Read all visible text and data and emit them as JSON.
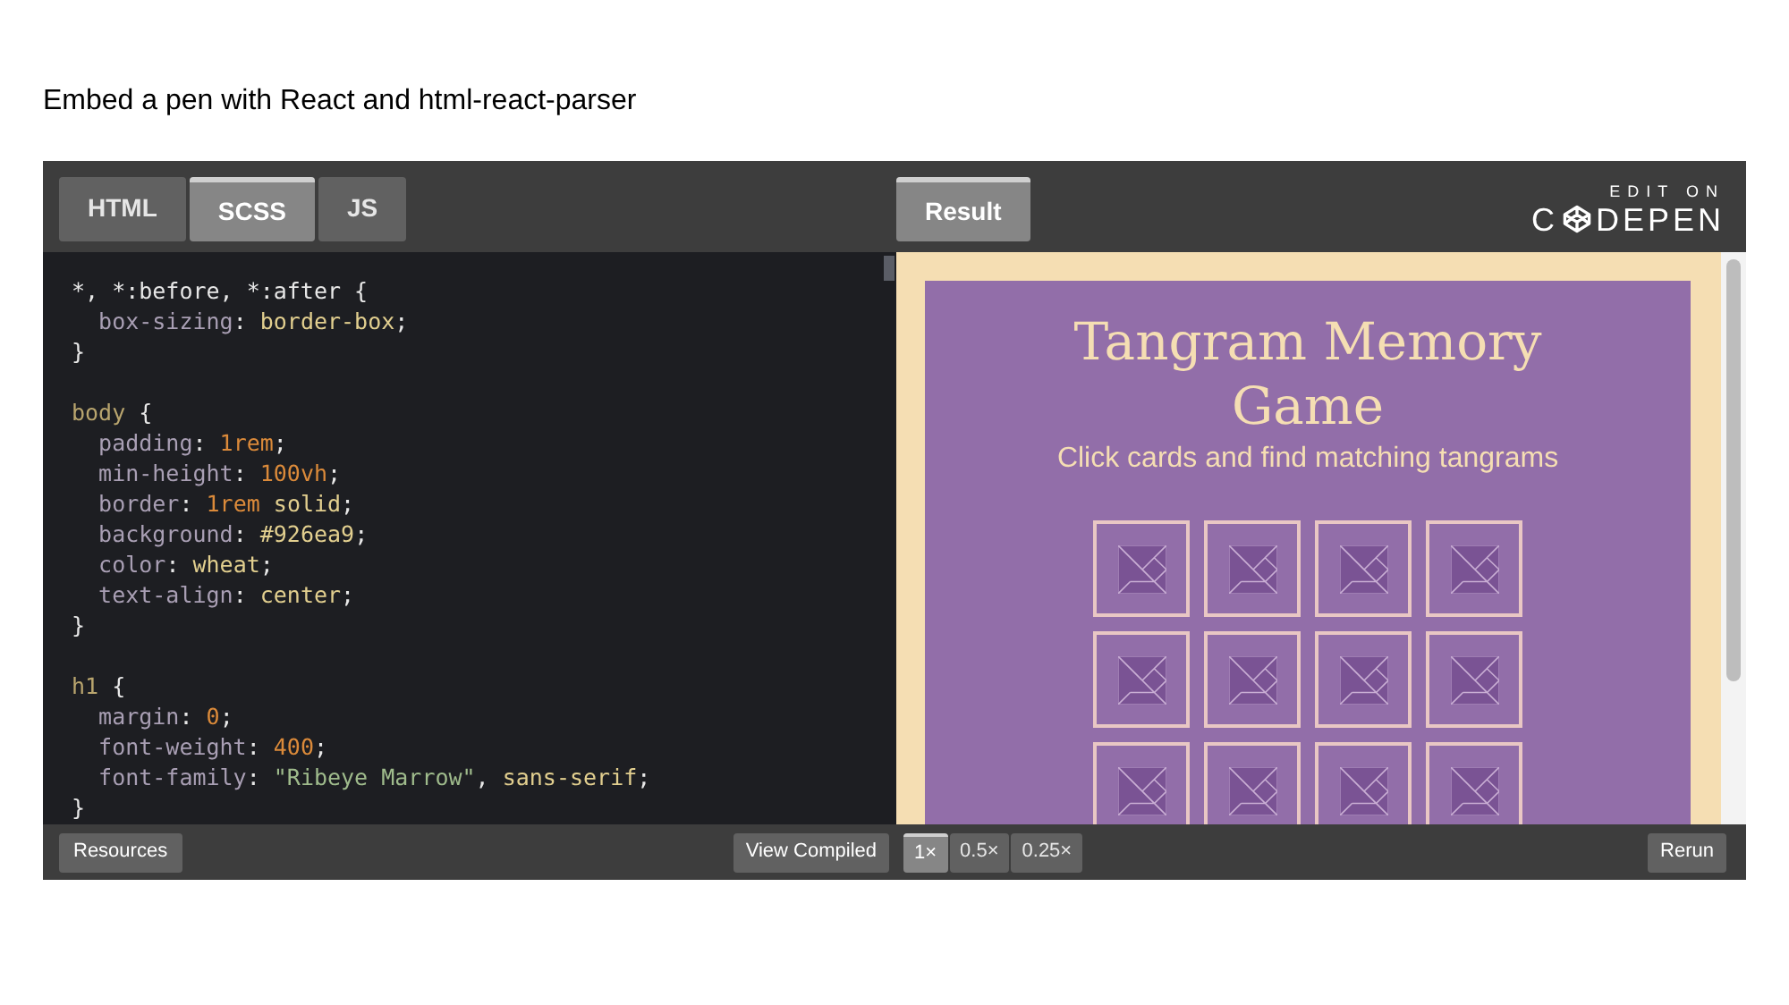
{
  "heading": "Embed a pen with React and html-react-parser",
  "editor_tabs": [
    {
      "label": "HTML",
      "selected": false
    },
    {
      "label": "SCSS",
      "selected": true
    },
    {
      "label": "JS",
      "selected": false
    }
  ],
  "result_tab": {
    "label": "Result",
    "selected": true
  },
  "logo": {
    "caption": "EDIT ON",
    "wordmark_start": "C",
    "wordmark_end": "DEPEN"
  },
  "code": {
    "blocks": [
      {
        "lines": [
          {
            "tokens": [
              {
                "kind": "punct",
                "text": "*, *:before, *:after {"
              }
            ]
          },
          {
            "tokens": [
              {
                "kind": "prop",
                "text": "  box-sizing"
              },
              {
                "kind": "punct",
                "text": ": "
              },
              {
                "kind": "value",
                "text": "border-box"
              },
              {
                "kind": "punct",
                "text": ";"
              }
            ]
          },
          {
            "tokens": [
              {
                "kind": "punct",
                "text": "}"
              }
            ]
          }
        ]
      },
      {
        "lines": [
          {
            "tokens": [
              {
                "kind": "selector",
                "text": "body"
              },
              {
                "kind": "punct",
                "text": " {"
              }
            ]
          },
          {
            "tokens": [
              {
                "kind": "prop",
                "text": "  padding"
              },
              {
                "kind": "punct",
                "text": ": "
              },
              {
                "kind": "number",
                "text": "1rem"
              },
              {
                "kind": "punct",
                "text": ";"
              }
            ]
          },
          {
            "tokens": [
              {
                "kind": "prop",
                "text": "  min-height"
              },
              {
                "kind": "punct",
                "text": ": "
              },
              {
                "kind": "number",
                "text": "100vh"
              },
              {
                "kind": "punct",
                "text": ";"
              }
            ]
          },
          {
            "tokens": [
              {
                "kind": "prop",
                "text": "  border"
              },
              {
                "kind": "punct",
                "text": ": "
              },
              {
                "kind": "number",
                "text": "1rem"
              },
              {
                "kind": "value",
                "text": " solid"
              },
              {
                "kind": "punct",
                "text": ";"
              }
            ]
          },
          {
            "tokens": [
              {
                "kind": "prop",
                "text": "  background"
              },
              {
                "kind": "punct",
                "text": ": "
              },
              {
                "kind": "value",
                "text": "#926ea9"
              },
              {
                "kind": "punct",
                "text": ";"
              }
            ]
          },
          {
            "tokens": [
              {
                "kind": "prop",
                "text": "  color"
              },
              {
                "kind": "punct",
                "text": ": "
              },
              {
                "kind": "value",
                "text": "wheat"
              },
              {
                "kind": "punct",
                "text": ";"
              }
            ]
          },
          {
            "tokens": [
              {
                "kind": "prop",
                "text": "  text-align"
              },
              {
                "kind": "punct",
                "text": ": "
              },
              {
                "kind": "value",
                "text": "center"
              },
              {
                "kind": "punct",
                "text": ";"
              }
            ]
          },
          {
            "tokens": [
              {
                "kind": "punct",
                "text": "}"
              }
            ]
          }
        ]
      },
      {
        "lines": [
          {
            "tokens": [
              {
                "kind": "selector",
                "text": "h1"
              },
              {
                "kind": "punct",
                "text": " {"
              }
            ]
          },
          {
            "tokens": [
              {
                "kind": "prop",
                "text": "  margin"
              },
              {
                "kind": "punct",
                "text": ": "
              },
              {
                "kind": "number",
                "text": "0"
              },
              {
                "kind": "punct",
                "text": ";"
              }
            ]
          },
          {
            "tokens": [
              {
                "kind": "prop",
                "text": "  font-weight"
              },
              {
                "kind": "punct",
                "text": ": "
              },
              {
                "kind": "number",
                "text": "400"
              },
              {
                "kind": "punct",
                "text": ";"
              }
            ]
          },
          {
            "tokens": [
              {
                "kind": "prop",
                "text": "  font-family"
              },
              {
                "kind": "punct",
                "text": ": "
              },
              {
                "kind": "string",
                "text": "\"Ribeye Marrow\""
              },
              {
                "kind": "punct",
                "text": ", "
              },
              {
                "kind": "value",
                "text": "sans-serif"
              },
              {
                "kind": "punct",
                "text": ";"
              }
            ]
          },
          {
            "tokens": [
              {
                "kind": "punct",
                "text": "}"
              }
            ]
          }
        ]
      }
    ]
  },
  "result": {
    "title": "Tangram Memory Game",
    "subtitle": "Click cards and find matching tangrams",
    "cards": [
      {
        "kind": "tangram"
      },
      {
        "kind": "tangram"
      },
      {
        "kind": "tangram"
      },
      {
        "kind": "tangram"
      },
      {
        "kind": "tangram"
      },
      {
        "kind": "tangram"
      },
      {
        "kind": "tangram"
      },
      {
        "kind": "tangram"
      },
      {
        "kind": "tangram"
      },
      {
        "kind": "tangram"
      },
      {
        "kind": "tangram"
      },
      {
        "kind": "tangram"
      }
    ]
  },
  "bottom_bar": {
    "resources": "Resources",
    "view_compiled": "View Compiled",
    "zoom": [
      {
        "label": "1×",
        "selected": true
      },
      {
        "label": "0.5×",
        "selected": false
      },
      {
        "label": "0.25×",
        "selected": false
      }
    ],
    "rerun": "Rerun"
  }
}
